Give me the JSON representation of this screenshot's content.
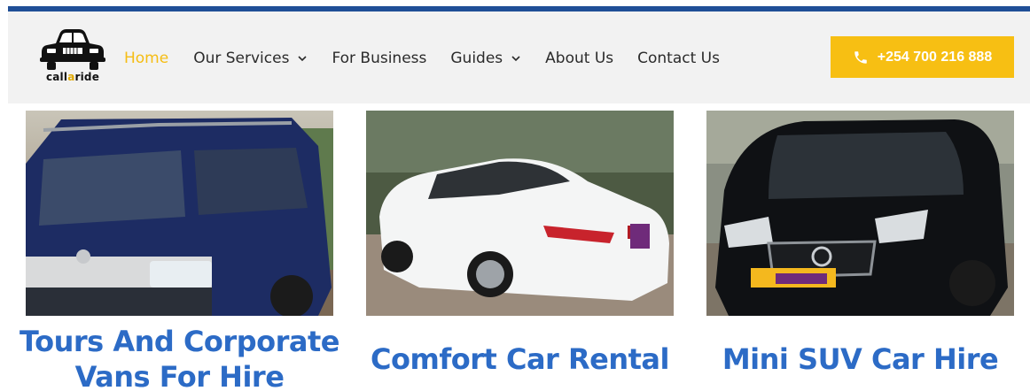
{
  "brand": {
    "logo_text_prefix": "call",
    "logo_text_accent": "a",
    "logo_text_suffix": "ride",
    "accent_color": "#f5bd14",
    "stripe_color": "#1f4f97",
    "title_color": "#2c6bc6"
  },
  "nav": {
    "items": [
      {
        "label": "Home",
        "active": true,
        "has_dropdown": false
      },
      {
        "label": "Our Services",
        "active": false,
        "has_dropdown": true
      },
      {
        "label": "For Business",
        "active": false,
        "has_dropdown": false
      },
      {
        "label": "Guides",
        "active": false,
        "has_dropdown": true
      },
      {
        "label": "About Us",
        "active": false,
        "has_dropdown": false
      },
      {
        "label": "Contact Us",
        "active": false,
        "has_dropdown": false
      }
    ]
  },
  "cta": {
    "phone": "+254 700 216 888",
    "icon": "phone-icon"
  },
  "cards": [
    {
      "title": "Tours And Corporate Vans For Hire",
      "image": "dark-blue-toyota-hiace-van-photo"
    },
    {
      "title": "Comfort Car Rental",
      "image": "white-toyota-mark-x-sedan-photo"
    },
    {
      "title": "Mini SUV Car Hire",
      "image": "black-nissan-dualis-suv-photo"
    }
  ]
}
